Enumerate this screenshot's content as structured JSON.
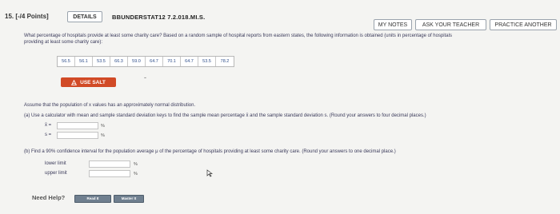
{
  "header": {
    "question_number": "15. [-/4 Points]",
    "details_label": "DETAILS",
    "assignment_id": "BBUNDERSTAT12 7.2.018.MI.S.",
    "my_notes_label": "MY NOTES",
    "ask_teacher_label": "ASK YOUR TEACHER",
    "practice_label": "PRACTICE ANOTHER"
  },
  "question": {
    "text_line1": "What percentage of hospitals provide at least some charity care? Based on a random sample of hospital reports from eastern states, the following information is obtained (units in percentage of hospitals",
    "text_line2": "providing at least some charity care):",
    "data_values": [
      "56.5",
      "56.1",
      "53.5",
      "66.3",
      "59.0",
      "64.7",
      "70.1",
      "64.7",
      "53.5",
      "78.2"
    ],
    "salt_label": "USE SALT",
    "dash_text": "-"
  },
  "assumption": "Assume that the population of x values has an approximately normal distribution.",
  "part_a": {
    "prompt": "(a)  Use a calculator with mean and sample standard deviation keys to find the sample mean percentage x̄ and the sample standard deviation s. (Round your answers to four decimal places.)",
    "xbar_label": "x̄ =",
    "s_label": "s =",
    "unit": "%"
  },
  "part_b": {
    "prompt": "(b)  Find a 90% confidence interval for the population average μ of the percentage of hospitals providing at least some charity care. (Round your answers to one decimal place.)",
    "lower_label": "lower limit",
    "upper_label": "upper limit",
    "unit": "%"
  },
  "help": {
    "need_help_label": "Need Help?",
    "read_it_label": "Read It",
    "master_it_label": "Master It"
  },
  "colors": {
    "salt_button": "#d14a26",
    "data_text": "#2d4d8a",
    "help_button": "#6f7f8f"
  }
}
